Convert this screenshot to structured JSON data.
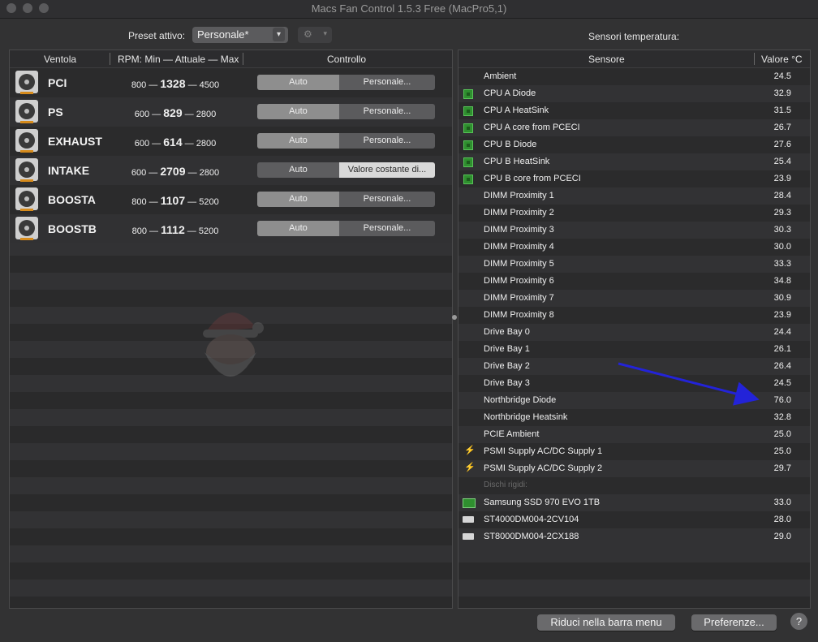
{
  "window": {
    "title": "Macs Fan Control 1.5.3 Free (MacPro5,1)"
  },
  "toolbar": {
    "preset_label": "Preset attivo:",
    "preset_value": "Personale*",
    "settings_icon": "gear-icon",
    "sensors_title": "Sensori temperatura:"
  },
  "fans": {
    "headers": {
      "fan": "Ventola",
      "rpm": "RPM: Min — Attuale — Max",
      "control": "Controllo"
    },
    "rows": [
      {
        "name": "PCI",
        "min": "800",
        "current": "1328",
        "max": "4500",
        "auto": "Auto",
        "mode": "Personale...",
        "mode_active": "auto"
      },
      {
        "name": "PS",
        "min": "600",
        "current": "829",
        "max": "2800",
        "auto": "Auto",
        "mode": "Personale...",
        "mode_active": "auto"
      },
      {
        "name": "EXHAUST",
        "min": "600",
        "current": "614",
        "max": "2800",
        "auto": "Auto",
        "mode": "Personale...",
        "mode_active": "auto"
      },
      {
        "name": "INTAKE",
        "min": "600",
        "current": "2709",
        "max": "2800",
        "auto": "Auto",
        "mode": "Valore costante di...",
        "mode_active": "custom"
      },
      {
        "name": "BOOSTA",
        "min": "800",
        "current": "1107",
        "max": "5200",
        "auto": "Auto",
        "mode": "Personale...",
        "mode_active": "auto"
      },
      {
        "name": "BOOSTB",
        "min": "800",
        "current": "1112",
        "max": "5200",
        "auto": "Auto",
        "mode": "Personale...",
        "mode_active": "auto"
      }
    ]
  },
  "sensors": {
    "headers": {
      "sensor": "Sensore",
      "value": "Valore °C"
    },
    "rows": [
      {
        "icon": "none",
        "name": "Ambient",
        "value": "24.5"
      },
      {
        "icon": "chip-icon",
        "name": "CPU A Diode",
        "value": "32.9"
      },
      {
        "icon": "chip-icon",
        "name": "CPU A HeatSink",
        "value": "31.5"
      },
      {
        "icon": "chip-icon",
        "name": "CPU A core from PCECI",
        "value": "26.7"
      },
      {
        "icon": "chip-icon",
        "name": "CPU B Diode",
        "value": "27.6"
      },
      {
        "icon": "chip-icon",
        "name": "CPU B HeatSink",
        "value": "25.4"
      },
      {
        "icon": "chip-icon",
        "name": "CPU B core from PCECI",
        "value": "23.9"
      },
      {
        "icon": "none",
        "name": "DIMM Proximity 1",
        "value": "28.4"
      },
      {
        "icon": "none",
        "name": "DIMM Proximity 2",
        "value": "29.3"
      },
      {
        "icon": "none",
        "name": "DIMM Proximity 3",
        "value": "30.3"
      },
      {
        "icon": "none",
        "name": "DIMM Proximity 4",
        "value": "30.0"
      },
      {
        "icon": "none",
        "name": "DIMM Proximity 5",
        "value": "33.3"
      },
      {
        "icon": "none",
        "name": "DIMM Proximity 6",
        "value": "34.8"
      },
      {
        "icon": "none",
        "name": "DIMM Proximity 7",
        "value": "30.9"
      },
      {
        "icon": "none",
        "name": "DIMM Proximity 8",
        "value": "23.9"
      },
      {
        "icon": "none",
        "name": "Drive Bay 0",
        "value": "24.4"
      },
      {
        "icon": "none",
        "name": "Drive Bay 1",
        "value": "26.1"
      },
      {
        "icon": "none",
        "name": "Drive Bay 2",
        "value": "26.4"
      },
      {
        "icon": "none",
        "name": "Drive Bay 3",
        "value": "24.5"
      },
      {
        "icon": "none",
        "name": "Northbridge Diode",
        "value": "76.0"
      },
      {
        "icon": "none",
        "name": "Northbridge Heatsink",
        "value": "32.8"
      },
      {
        "icon": "none",
        "name": "PCIE Ambient",
        "value": "25.0"
      },
      {
        "icon": "bolt-icon",
        "name": "PSMI Supply AC/DC Supply 1",
        "value": "25.0"
      },
      {
        "icon": "bolt-icon",
        "name": "PSMI Supply AC/DC Supply 2",
        "value": "29.7"
      },
      {
        "icon": "group",
        "name": "Dischi rigidi:",
        "value": ""
      },
      {
        "icon": "ssd-icon",
        "name": "Samsung SSD 970 EVO 1TB",
        "value": "33.0"
      },
      {
        "icon": "hdd-icon",
        "name": "ST4000DM004-2CV104",
        "value": "28.0"
      },
      {
        "icon": "hdd-icon",
        "name": "ST8000DM004-2CX188",
        "value": "29.0"
      }
    ]
  },
  "footer": {
    "minimize_label": "Riduci nella barra menu",
    "prefs_label": "Preferenze...",
    "help_label": "?"
  },
  "colors": {
    "annotation_arrow": "#2323d8",
    "chip_green": "#2f8f2f",
    "bolt_yellow": "#e3c425"
  }
}
